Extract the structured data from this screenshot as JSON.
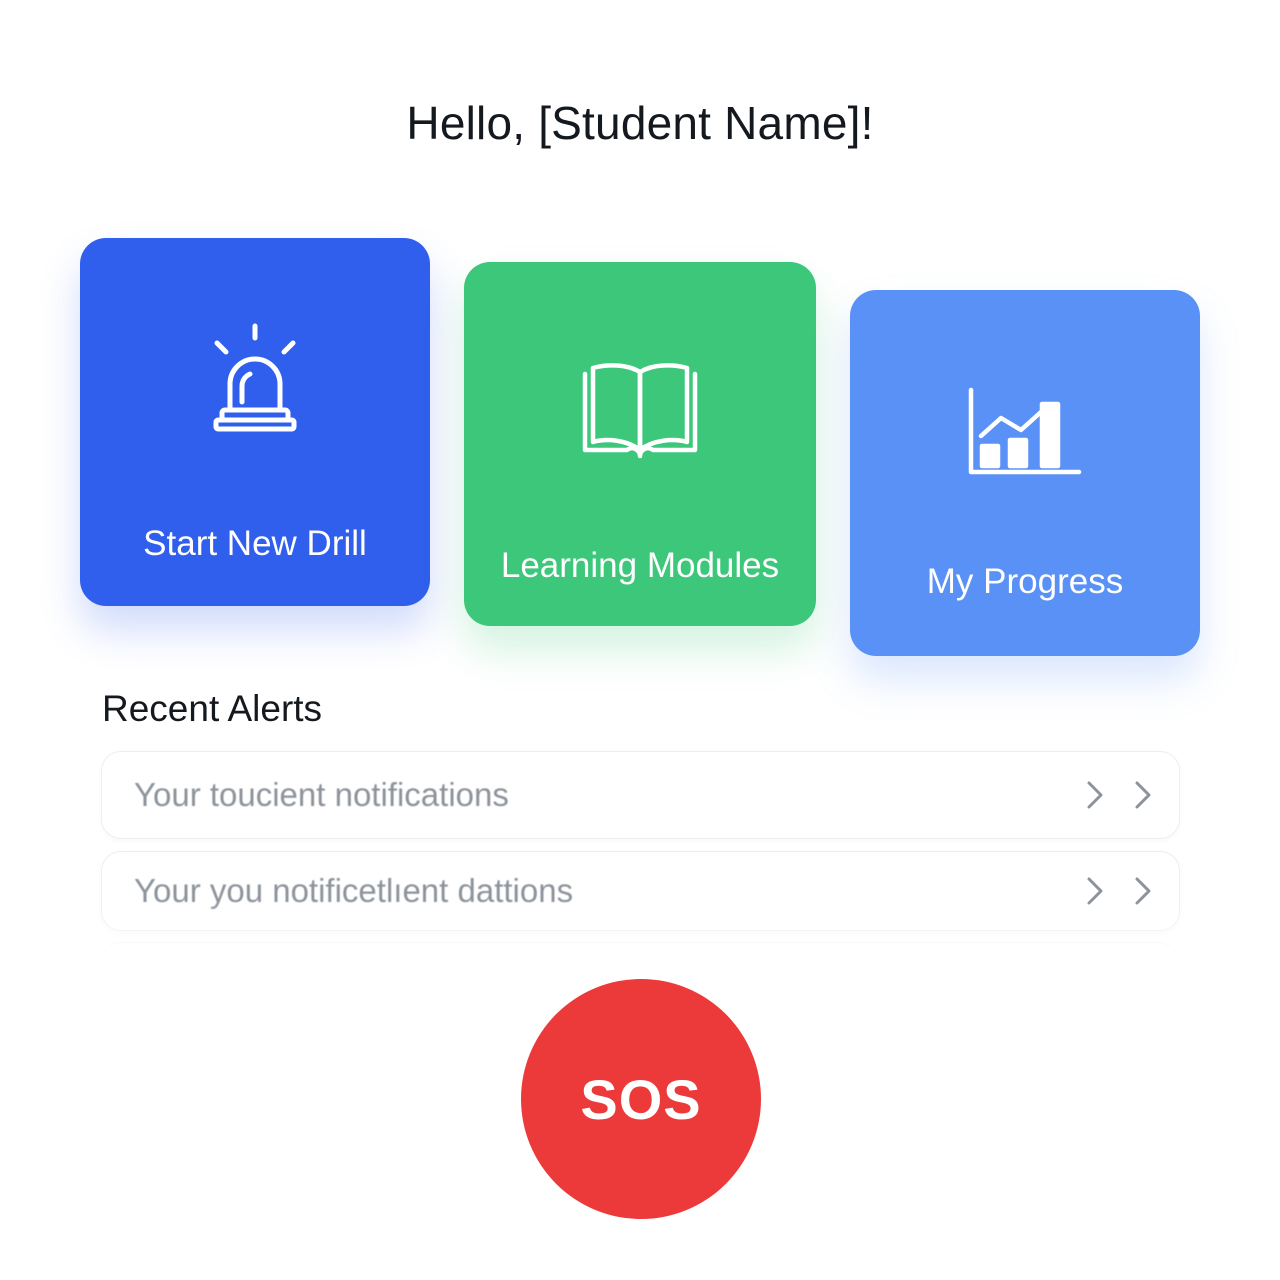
{
  "header": {
    "greeting": "Hello, [Student Name]!"
  },
  "cards": {
    "drill": {
      "label": "Start New Drill",
      "icon": "siren-icon",
      "color": "#2f5fec"
    },
    "modules": {
      "label": "Learning Modules",
      "icon": "open-book-icon",
      "color": "#3cc77a"
    },
    "progress": {
      "label": "My Progress",
      "icon": "bar-chart-icon",
      "color": "#5a91f6"
    }
  },
  "alerts": {
    "title": "Recent Alerts",
    "items": [
      {
        "text": "Your toucient notifications"
      },
      {
        "text": "Your you notificetlıent dattions"
      }
    ]
  },
  "sos": {
    "label": "SOS",
    "color": "#ec3a3b"
  }
}
